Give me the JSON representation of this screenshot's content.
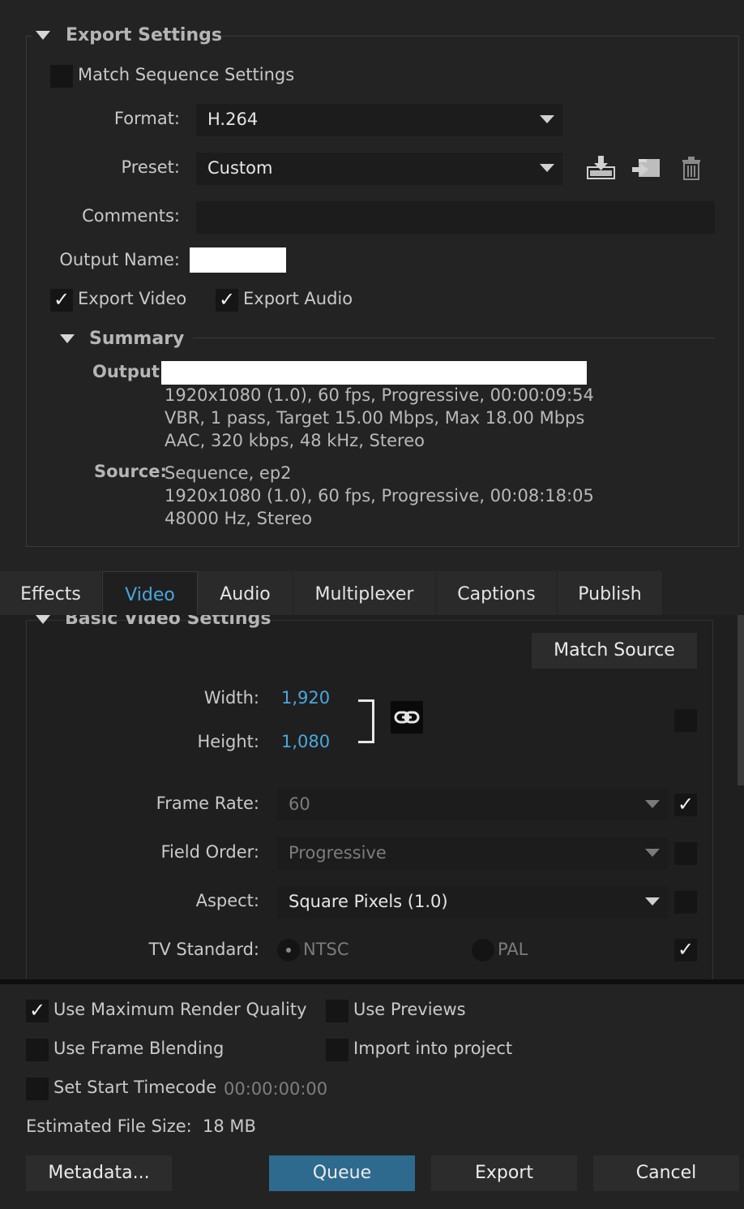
{
  "export_settings": {
    "title": "Export Settings",
    "match_sequence_label": "Match Sequence Settings",
    "format_label": "Format:",
    "format_value": "H.264",
    "preset_label": "Preset:",
    "preset_value": "Custom",
    "comments_label": "Comments:",
    "comments_value": "",
    "output_name_label": "Output Name:",
    "output_name_value": "",
    "export_video_label": "Export Video",
    "export_audio_label": "Export Audio",
    "export_video_checked": true,
    "export_audio_checked": true,
    "icons": [
      "save-preset-icon",
      "import-preset-icon",
      "delete-preset-icon"
    ]
  },
  "summary": {
    "title": "Summary",
    "output_label": "Output:",
    "output_lines": [
      "1920x1080 (1.0), 60 fps, Progressive, 00:00:09:54",
      "VBR, 1 pass, Target 15.00 Mbps, Max 18.00 Mbps",
      "AAC, 320 kbps, 48 kHz, Stereo"
    ],
    "source_label": "Source:",
    "source_lines": [
      "Sequence, ep2",
      "1920x1080 (1.0), 60 fps, Progressive, 00:08:18:05",
      "48000 Hz, Stereo"
    ]
  },
  "tabs": [
    "Effects",
    "Video",
    "Audio",
    "Multiplexer",
    "Captions",
    "Publish"
  ],
  "active_tab": "Video",
  "video": {
    "section_title": "Basic Video Settings",
    "match_source_label": "Match Source",
    "width_label": "Width:",
    "width_value": "1,920",
    "height_label": "Height:",
    "height_value": "1,080",
    "frame_rate_label": "Frame Rate:",
    "frame_rate_value": "60",
    "field_order_label": "Field Order:",
    "field_order_value": "Progressive",
    "aspect_label": "Aspect:",
    "aspect_value": "Square Pixels (1.0)",
    "tv_standard_label": "TV Standard:",
    "ntsc_label": "NTSC",
    "pal_label": "PAL",
    "check_mark": "✓"
  },
  "bottom": {
    "max_render_label": "Use Maximum Render Quality",
    "use_previews_label": "Use Previews",
    "frame_blending_label": "Use Frame Blending",
    "import_label": "Import into project",
    "start_tc_label": "Set Start Timecode",
    "start_tc_value": "00:00:00:00",
    "file_size_label": "Estimated File Size:",
    "file_size_value": "18 MB",
    "metadata_btn": "Metadata...",
    "queue_btn": "Queue",
    "export_btn": "Export",
    "cancel_btn": "Cancel"
  },
  "colors": {
    "accent": "#4aa8de",
    "primary_button": "#2e6a8e",
    "background": "#232323"
  }
}
